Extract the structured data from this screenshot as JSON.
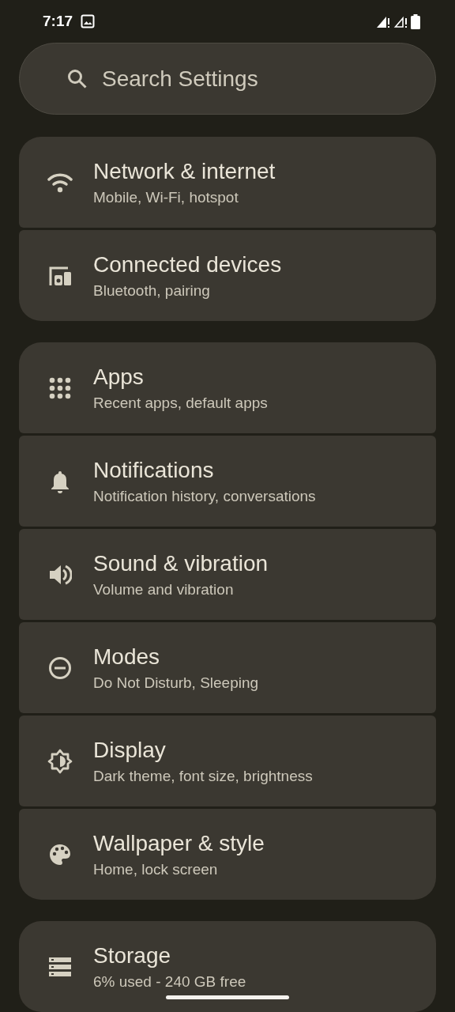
{
  "status_bar": {
    "time": "7:17"
  },
  "search": {
    "placeholder": "Search Settings"
  },
  "groups": [
    {
      "items": [
        {
          "title": "Network & internet",
          "subtitle": "Mobile, Wi-Fi, hotspot"
        },
        {
          "title": "Connected devices",
          "subtitle": "Bluetooth, pairing"
        }
      ]
    },
    {
      "items": [
        {
          "title": "Apps",
          "subtitle": "Recent apps, default apps"
        },
        {
          "title": "Notifications",
          "subtitle": "Notification history, conversations"
        },
        {
          "title": "Sound & vibration",
          "subtitle": "Volume and vibration"
        },
        {
          "title": "Modes",
          "subtitle": "Do Not Disturb, Sleeping"
        },
        {
          "title": "Display",
          "subtitle": "Dark theme, font size, brightness"
        },
        {
          "title": "Wallpaper & style",
          "subtitle": "Home, lock screen"
        }
      ]
    },
    {
      "items": [
        {
          "title": "Storage",
          "subtitle": "6% used - 240 GB free"
        }
      ]
    }
  ]
}
